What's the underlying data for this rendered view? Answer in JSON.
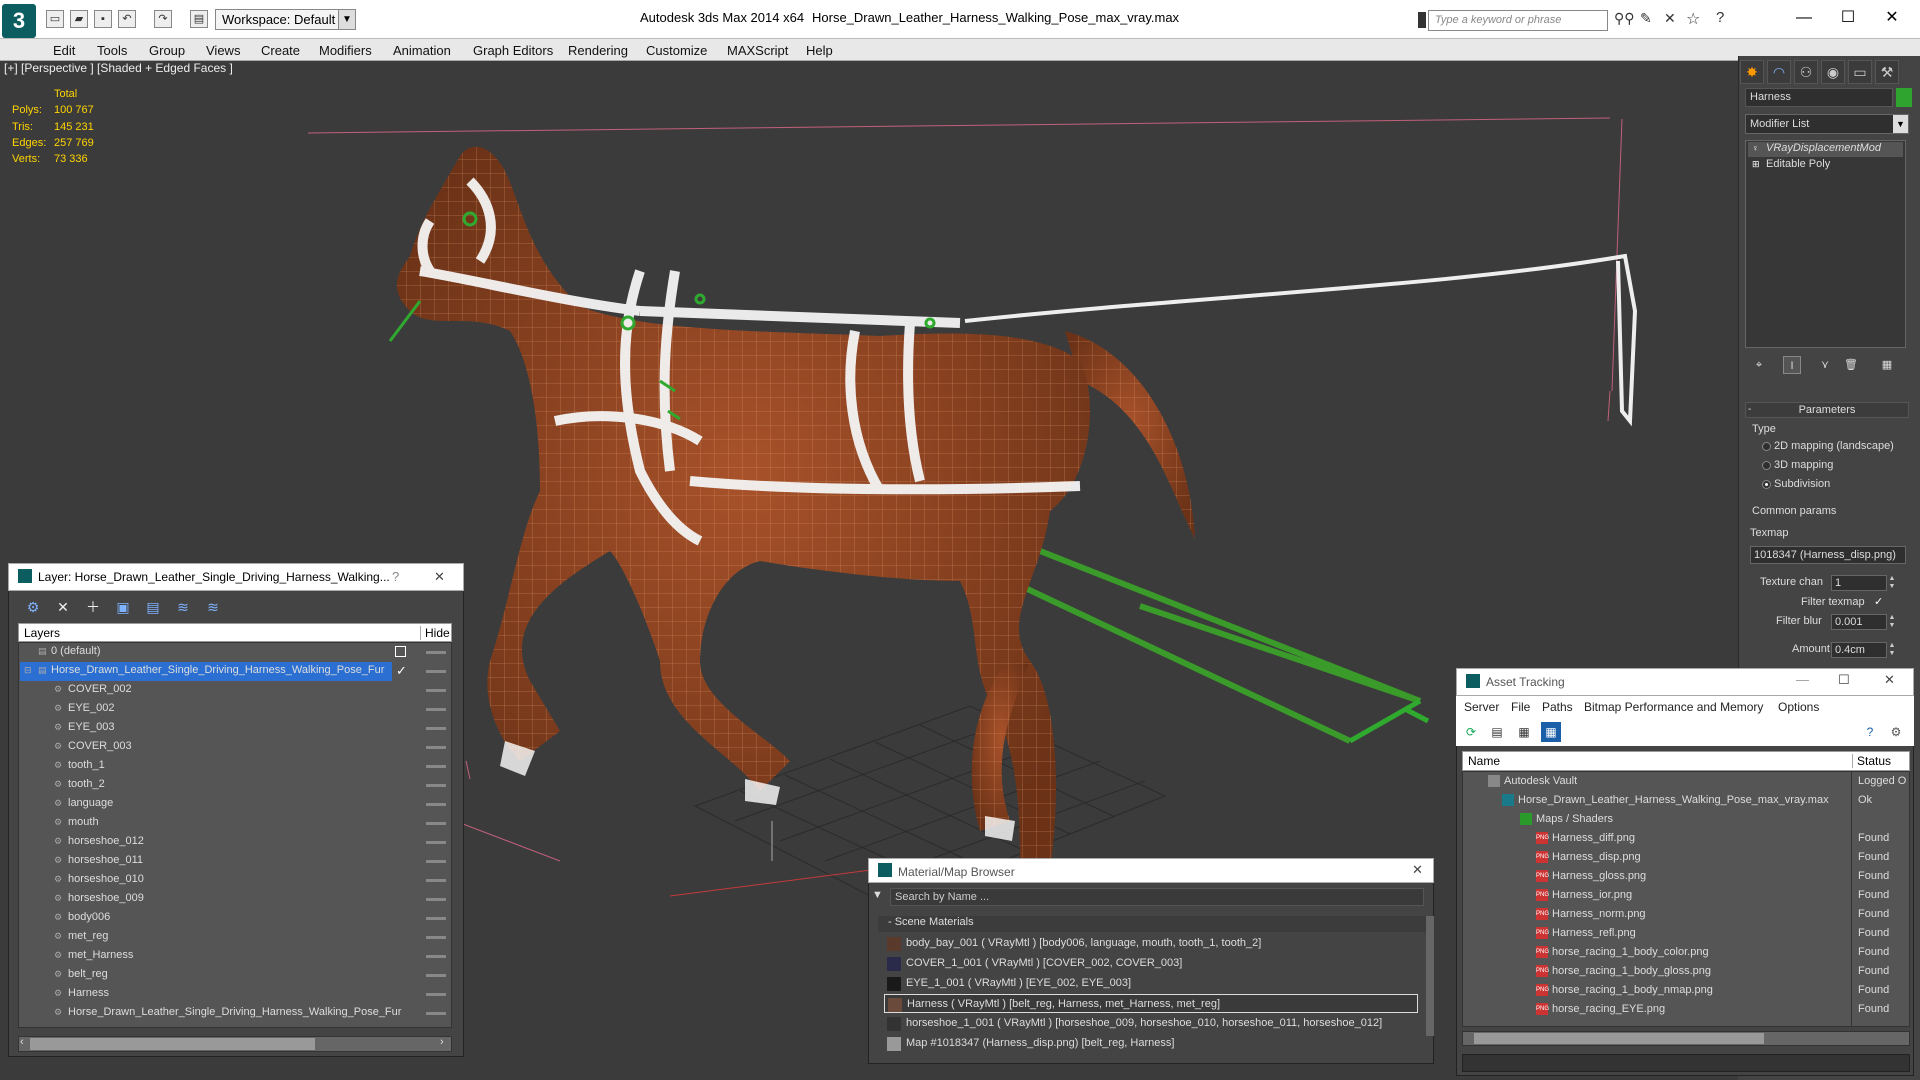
{
  "window": {
    "workspace": "Workspace: Default",
    "app_title": "Autodesk 3ds Max  2014 x64",
    "doc_title": "Horse_Drawn_Leather_Harness_Walking_Pose_max_vray.max",
    "search_placeholder": "Type a keyword or phrase"
  },
  "menu": [
    "Edit",
    "Tools",
    "Group",
    "Views",
    "Create",
    "Modifiers",
    "Animation",
    "Graph Editors",
    "Rendering",
    "Customize",
    "MAXScript",
    "Help"
  ],
  "viewport": {
    "label": "[+] [Perspective ] [Shaded + Edged Faces ]",
    "stats": {
      "header": "Total",
      "rows": [
        {
          "label": "Polys:",
          "value": "100 767"
        },
        {
          "label": "Tris:",
          "value": "145 231"
        },
        {
          "label": "Edges:",
          "value": "257 769"
        },
        {
          "label": "Verts:",
          "value": "73 336"
        }
      ]
    }
  },
  "command_panel": {
    "object_name": "Harness",
    "object_color": "#2fa52f",
    "modifier_list": "Modifier List",
    "stack": [
      "VRayDisplacementMod",
      "Editable Poly"
    ],
    "params_header": "Parameters",
    "type_label": "Type",
    "type_options": [
      {
        "label": "2D mapping (landscape)",
        "selected": false
      },
      {
        "label": "3D mapping",
        "selected": false
      },
      {
        "label": "Subdivision",
        "selected": true
      }
    ],
    "common_params": "Common params",
    "texmap_label": "Texmap",
    "texmap_value": "1018347 (Harness_disp.png)",
    "texture_chan_label": "Texture chan",
    "texture_chan_value": "1",
    "filter_texmap_label": "Filter texmap",
    "filter_blur_label": "Filter blur",
    "filter_blur_value": "0.001",
    "amount_label": "Amount",
    "amount_value": "0.4cm"
  },
  "layer_dialog": {
    "title": "Layer: Horse_Drawn_Leather_Single_Driving_Harness_Walking...",
    "help": "?",
    "close": "✕",
    "col_layers": "Layers",
    "col_hide": "Hide",
    "rows": [
      "0 (default)",
      "Horse_Drawn_Leather_Single_Driving_Harness_Walking_Pose_Fur",
      "COVER_002",
      "EYE_002",
      "EYE_003",
      "COVER_003",
      "tooth_1",
      "tooth_2",
      "language",
      "mouth",
      "horseshoe_012",
      "horseshoe_011",
      "horseshoe_010",
      "horseshoe_009",
      "body006",
      "met_reg",
      "met_Harness",
      "belt_reg",
      "Harness",
      "Horse_Drawn_Leather_Single_Driving_Harness_Walking_Pose_Fur"
    ]
  },
  "material_browser": {
    "title": "Material/Map Browser",
    "search_placeholder": "Search by Name ...",
    "section": "- Scene Materials",
    "rows": [
      "body_bay_001  ( VRayMtl ) [body006, language, mouth, tooth_1, tooth_2]",
      "COVER_1_001  ( VRayMtl ) [COVER_002, COVER_003]",
      "EYE_1_001  ( VRayMtl ) [EYE_002, EYE_003]",
      "Harness  ( VRayMtl ) [belt_reg, Harness, met_Harness, met_reg]",
      "horseshoe_1_001  ( VRayMtl ) [horseshoe_009, horseshoe_010, horseshoe_011, horseshoe_012]",
      "Map #1018347 (Harness_disp.png) [belt_reg, Harness]"
    ]
  },
  "asset_tracking": {
    "title": "Asset Tracking",
    "menu": [
      "Server",
      "File",
      "Paths",
      "Bitmap Performance and Memory",
      "Options"
    ],
    "col_name": "Name",
    "col_status": "Status",
    "rows": [
      {
        "name": "Autodesk Vault",
        "status": "Logged O"
      },
      {
        "name": "Horse_Drawn_Leather_Harness_Walking_Pose_max_vray.max",
        "status": "Ok"
      },
      {
        "name": "Maps / Shaders",
        "status": ""
      },
      {
        "name": "Harness_diff.png",
        "status": "Found"
      },
      {
        "name": "Harness_disp.png",
        "status": "Found"
      },
      {
        "name": "Harness_gloss.png",
        "status": "Found"
      },
      {
        "name": "Harness_ior.png",
        "status": "Found"
      },
      {
        "name": "Harness_norm.png",
        "status": "Found"
      },
      {
        "name": "Harness_refl.png",
        "status": "Found"
      },
      {
        "name": "horse_racing_1_body_color.png",
        "status": "Found"
      },
      {
        "name": "horse_racing_1_body_gloss.png",
        "status": "Found"
      },
      {
        "name": "horse_racing_1_body_nmap.png",
        "status": "Found"
      },
      {
        "name": "horse_racing_EYE.png",
        "status": "Found"
      }
    ]
  }
}
